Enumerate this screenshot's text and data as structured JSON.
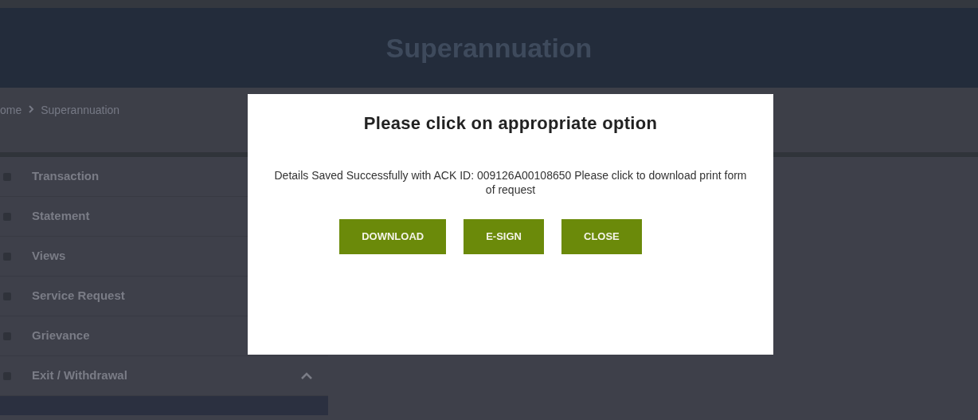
{
  "header": {
    "title": "Superannuation"
  },
  "breadcrumb": [
    "ome",
    "Superannuation"
  ],
  "sidebar": {
    "items": [
      {
        "label": "Transaction",
        "kind": "link"
      },
      {
        "label": "Statement",
        "kind": "link"
      },
      {
        "label": "Views",
        "kind": "link"
      },
      {
        "label": "Service Request",
        "kind": "link"
      },
      {
        "label": "Grievance",
        "kind": "link"
      },
      {
        "label": "Exit / Withdrawal",
        "expanded": true,
        "kind": "group"
      }
    ]
  },
  "dialog": {
    "title": "Please click on appropriate option",
    "message": "Details Saved Successfully with ACK ID: 009126A00108650 Please click to download print form of request",
    "buttons": [
      "DOWNLOAD",
      "E-SIGN",
      "CLOSE"
    ]
  }
}
